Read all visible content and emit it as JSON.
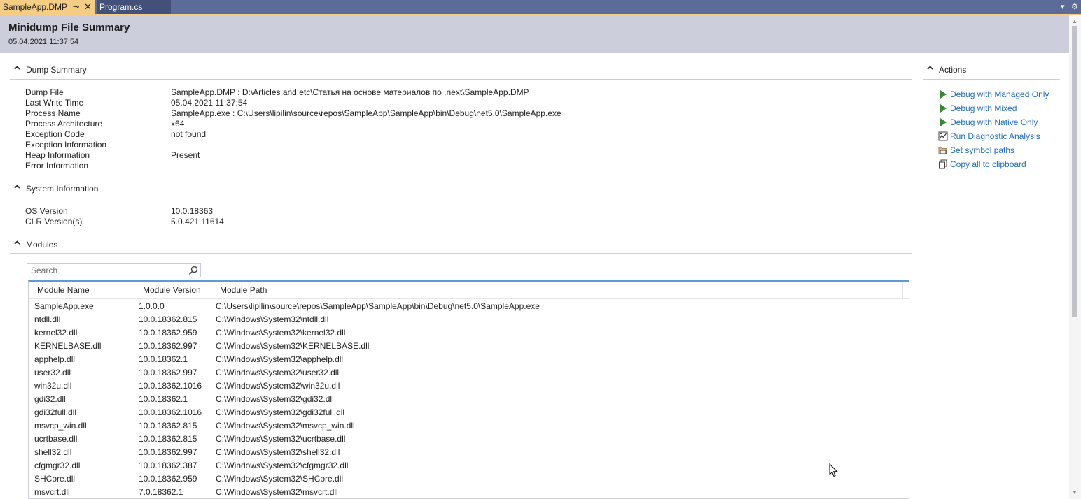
{
  "tabs": [
    {
      "label": "SampleApp.DMP",
      "active": true
    },
    {
      "label": "Program.cs",
      "active": false
    }
  ],
  "tab_icons": {
    "pin": "⊸",
    "close": "✕",
    "dropdown": "▾",
    "settings": "⚙"
  },
  "header": {
    "title": "Minidump File Summary",
    "timestamp": "05.04.2021 11:37:54"
  },
  "dump_summary": {
    "title": "Dump Summary",
    "rows": [
      {
        "key": "Dump File",
        "value": "SampleApp.DMP : D:\\Articles and etc\\Статья на основе материалов по .next\\SampleApp.DMP"
      },
      {
        "key": "Last Write Time",
        "value": "05.04.2021 11:37:54"
      },
      {
        "key": "Process Name",
        "value": "SampleApp.exe : C:\\Users\\lipilin\\source\\repos\\SampleApp\\SampleApp\\bin\\Debug\\net5.0\\SampleApp.exe"
      },
      {
        "key": "Process Architecture",
        "value": "x64"
      },
      {
        "key": "Exception Code",
        "value": "not found"
      },
      {
        "key": "Exception Information",
        "value": ""
      },
      {
        "key": "Heap Information",
        "value": "Present"
      },
      {
        "key": "Error Information",
        "value": ""
      }
    ]
  },
  "system_info": {
    "title": "System Information",
    "rows": [
      {
        "key": "OS Version",
        "value": "10.0.18363"
      },
      {
        "key": "CLR Version(s)",
        "value": "5.0.421.11614"
      }
    ]
  },
  "modules": {
    "title": "Modules",
    "search_placeholder": "Search",
    "columns": [
      "Module Name",
      "Module Version",
      "Module Path"
    ],
    "rows": [
      [
        "SampleApp.exe",
        "1.0.0.0",
        "C:\\Users\\lipilin\\source\\repos\\SampleApp\\SampleApp\\bin\\Debug\\net5.0\\SampleApp.exe"
      ],
      [
        "ntdll.dll",
        "10.0.18362.815",
        "C:\\Windows\\System32\\ntdll.dll"
      ],
      [
        "kernel32.dll",
        "10.0.18362.959",
        "C:\\Windows\\System32\\kernel32.dll"
      ],
      [
        "KERNELBASE.dll",
        "10.0.18362.997",
        "C:\\Windows\\System32\\KERNELBASE.dll"
      ],
      [
        "apphelp.dll",
        "10.0.18362.1",
        "C:\\Windows\\System32\\apphelp.dll"
      ],
      [
        "user32.dll",
        "10.0.18362.997",
        "C:\\Windows\\System32\\user32.dll"
      ],
      [
        "win32u.dll",
        "10.0.18362.1016",
        "C:\\Windows\\System32\\win32u.dll"
      ],
      [
        "gdi32.dll",
        "10.0.18362.1",
        "C:\\Windows\\System32\\gdi32.dll"
      ],
      [
        "gdi32full.dll",
        "10.0.18362.1016",
        "C:\\Windows\\System32\\gdi32full.dll"
      ],
      [
        "msvcp_win.dll",
        "10.0.18362.815",
        "C:\\Windows\\System32\\msvcp_win.dll"
      ],
      [
        "ucrtbase.dll",
        "10.0.18362.815",
        "C:\\Windows\\System32\\ucrtbase.dll"
      ],
      [
        "shell32.dll",
        "10.0.18362.997",
        "C:\\Windows\\System32\\shell32.dll"
      ],
      [
        "cfgmgr32.dll",
        "10.0.18362.387",
        "C:\\Windows\\System32\\cfgmgr32.dll"
      ],
      [
        "SHCore.dll",
        "10.0.18362.959",
        "C:\\Windows\\System32\\SHCore.dll"
      ],
      [
        "msvcrt.dll",
        "7.0.18362.1",
        "C:\\Windows\\System32\\msvcrt.dll"
      ]
    ]
  },
  "actions": {
    "title": "Actions",
    "items": [
      {
        "label": "Debug with Managed Only",
        "icon": "play-icon"
      },
      {
        "label": "Debug with Mixed",
        "icon": "play-icon"
      },
      {
        "label": "Debug with Native Only",
        "icon": "play-icon"
      },
      {
        "label": "Run Diagnostic Analysis",
        "icon": "diagnostic-icon"
      },
      {
        "label": "Set symbol paths",
        "icon": "symbol-paths-icon"
      },
      {
        "label": "Copy all to clipboard",
        "icon": "copy-icon"
      }
    ]
  },
  "colors": {
    "tab_strip": "#5d6b99",
    "active_tab": "#f5cc84",
    "header_bg": "#cccedb",
    "link": "#1e6bb8",
    "play_green": "#388a34",
    "grid_accent": "#5d9bd5"
  }
}
